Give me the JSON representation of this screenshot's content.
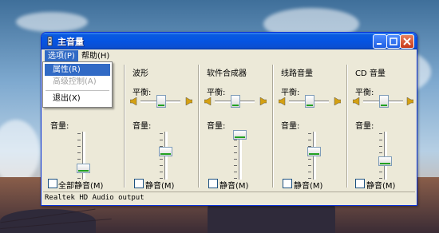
{
  "window": {
    "title": "主音量"
  },
  "menu": {
    "items": [
      {
        "label": "选项(P)",
        "active": true
      },
      {
        "label": "帮助(H)",
        "active": false
      }
    ],
    "dropdown": [
      {
        "label": "属性(R)",
        "state": "highlighted"
      },
      {
        "label": "高级控制(A)",
        "state": "disabled"
      },
      {
        "label": "退出(X)",
        "state": "normal"
      }
    ]
  },
  "channels": [
    {
      "title": "",
      "balance_label": "",
      "volume_label": "音量:",
      "mute_label": "全部静音(M)",
      "mute_checked": false,
      "volume_level": 0.18,
      "balance_level": 0.5
    },
    {
      "title": "波形",
      "balance_label": "平衡:",
      "volume_label": "音量:",
      "mute_label": "静音(M)",
      "mute_checked": false,
      "volume_level": 0.55,
      "balance_level": 0.5
    },
    {
      "title": "软件合成器",
      "balance_label": "平衡:",
      "volume_label": "音量:",
      "mute_label": "静音(M)",
      "mute_checked": false,
      "volume_level": 0.95,
      "balance_level": 0.5
    },
    {
      "title": "线路音量",
      "balance_label": "平衡:",
      "volume_label": "音量:",
      "mute_label": "静音(M)",
      "mute_checked": false,
      "volume_level": 0.55,
      "balance_level": 0.5
    },
    {
      "title": "CD 音量",
      "balance_label": "平衡:",
      "volume_label": "音量:",
      "mute_label": "静音(M)",
      "mute_checked": false,
      "volume_level": 0.3,
      "balance_level": 0.5
    }
  ],
  "status_bar": "Realtek HD Audio output",
  "colors": {
    "titlebar": "#0554e2",
    "highlight": "#316ac5",
    "panel": "#ece9d8"
  }
}
